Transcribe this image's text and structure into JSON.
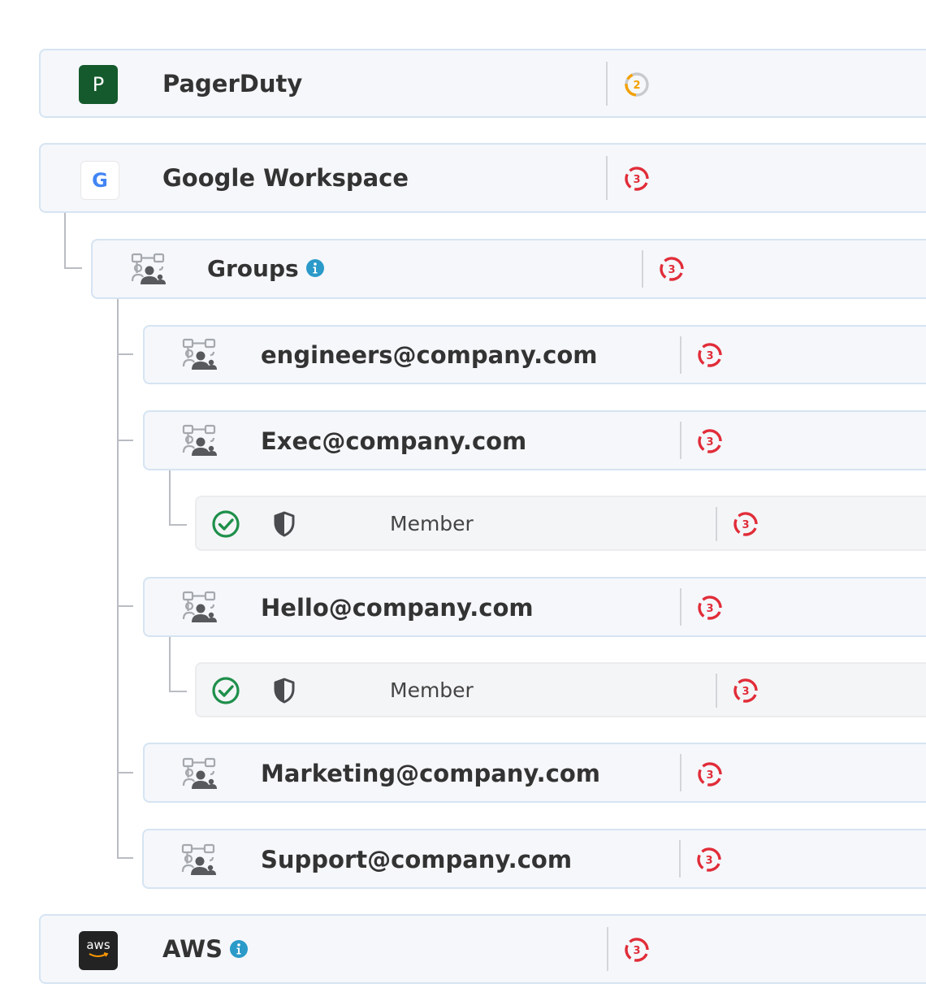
{
  "colors": {
    "accent_info": "#2b9ac9",
    "status_red": "#e12d39",
    "status_orange": "#f4a100",
    "check_green": "#1e8f4a"
  },
  "integrations": [
    {
      "name": "PagerDuty",
      "logo_text": "P",
      "badge": "2",
      "badge_color": "orange"
    },
    {
      "name": "Google Workspace",
      "logo_text": "G",
      "badge": "3",
      "badge_color": "red"
    },
    {
      "name": "AWS",
      "logo_text": "aws",
      "badge": "3",
      "badge_color": "red",
      "has_info": true
    }
  ],
  "groups_node": {
    "name": "Groups",
    "badge": "3",
    "icon": "group-users-icon",
    "has_info": true
  },
  "groups": [
    {
      "name": "engineers@company.com",
      "badge": "3"
    },
    {
      "name": "Exec@company.com",
      "badge": "3",
      "member": {
        "label": "Member",
        "badge": "3"
      }
    },
    {
      "name": "Hello@company.com",
      "badge": "3",
      "member": {
        "label": "Member",
        "badge": "3"
      }
    },
    {
      "name": "Marketing@company.com",
      "badge": "3"
    },
    {
      "name": "Support@company.com",
      "badge": "3"
    }
  ]
}
